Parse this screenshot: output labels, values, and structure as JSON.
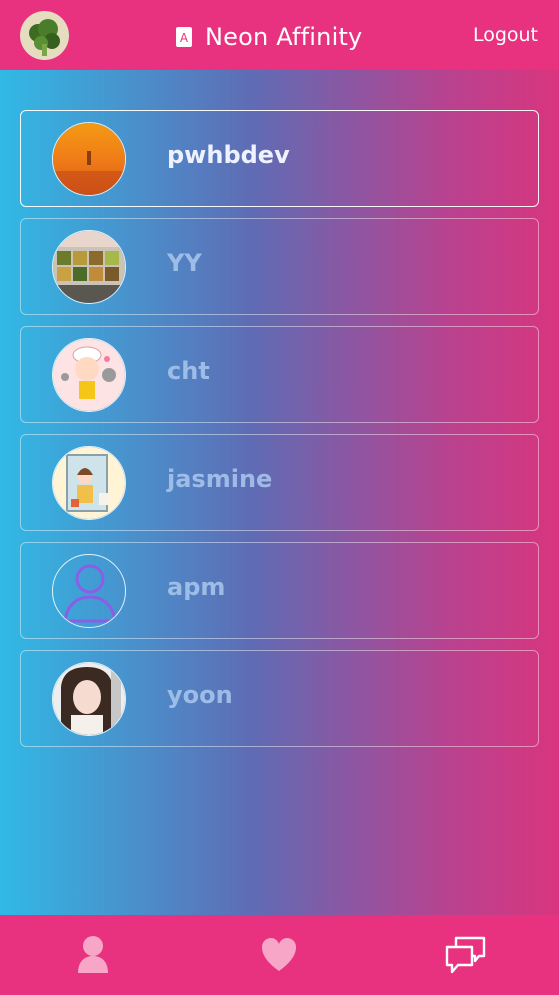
{
  "header": {
    "title": "Neon Affinity",
    "logout_label": "Logout",
    "brand_icon": "card-icon"
  },
  "users": [
    {
      "name": "pwhbdev",
      "active": true
    },
    {
      "name": "YY",
      "active": false
    },
    {
      "name": "cht",
      "active": false
    },
    {
      "name": "jasmine",
      "active": false
    },
    {
      "name": "apm",
      "active": false
    },
    {
      "name": "yoon",
      "active": false
    }
  ],
  "footer": {
    "tabs": [
      "profile-icon",
      "heart-icon",
      "chat-icon"
    ]
  },
  "colors": {
    "header_bg": "#e8327f",
    "gradient_left": "#31b9e5",
    "gradient_right": "#d9357e"
  }
}
